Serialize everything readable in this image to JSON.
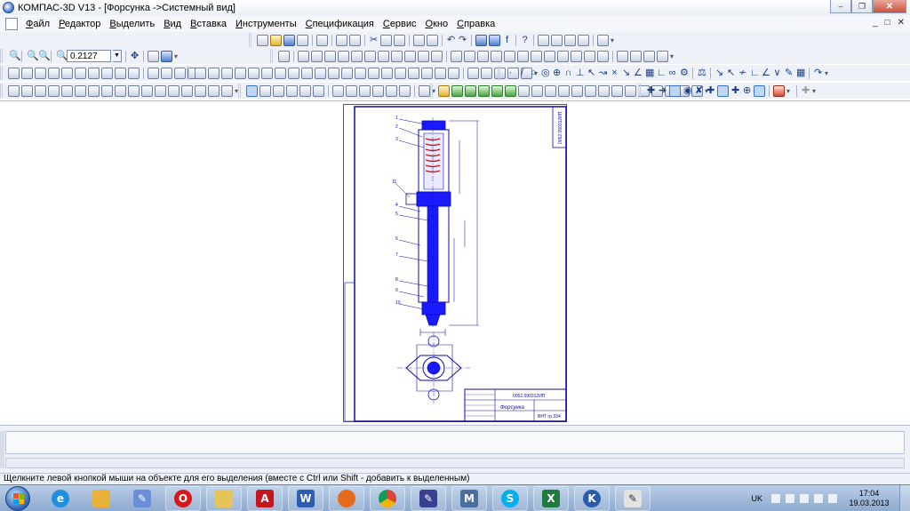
{
  "window": {
    "title": "КОМПАС-3D V13 - [Форсунка ->Системный вид]",
    "controls": [
      "minimize",
      "restore",
      "close"
    ]
  },
  "menu": {
    "items": [
      "Файл",
      "Редактор",
      "Выделить",
      "Вид",
      "Вставка",
      "Инструменты",
      "Спецификация",
      "Сервис",
      "Окно",
      "Справка"
    ],
    "doc_controls": [
      "minimize",
      "restore",
      "close"
    ]
  },
  "toolbar": {
    "zoom_value": "0.2127"
  },
  "drawing": {
    "title_block": {
      "doc_code": "0052.090312ИП",
      "name": "Форсунка",
      "org": "ВНТ гр 334"
    },
    "stamp_code": "0052.090312ИП",
    "leader_numbers": [
      "1",
      "2",
      "3",
      "11",
      "4",
      "5",
      "6",
      "7",
      "8",
      "9",
      "10"
    ]
  },
  "status": {
    "hint": "Щелкните левой кнопкой мыши на объекте для его выделения (вместе с Ctrl или Shift - добавить к выделенным)"
  },
  "taskbar": {
    "apps": [
      {
        "name": "explorer",
        "icon": "folder-icon"
      },
      {
        "name": "internet-explorer",
        "icon": "ie-icon"
      },
      {
        "name": "paint-tool",
        "icon": "paint-icon"
      },
      {
        "name": "opera",
        "icon": "opera-icon"
      },
      {
        "name": "file-manager",
        "icon": "folder-icon"
      },
      {
        "name": "acrobat",
        "icon": "pdf-icon"
      },
      {
        "name": "word",
        "icon": "word-icon"
      },
      {
        "name": "firefox",
        "icon": "firefox-icon"
      },
      {
        "name": "chrome",
        "icon": "chrome-icon"
      },
      {
        "name": "mathcad",
        "icon": "mathcad-icon"
      },
      {
        "name": "skype",
        "icon": "skype-icon"
      },
      {
        "name": "excel",
        "icon": "excel-icon"
      },
      {
        "name": "kompas",
        "icon": "kompas-icon"
      },
      {
        "name": "paint",
        "icon": "brush-icon"
      }
    ],
    "lang": "UK",
    "time": "17:04",
    "date": "19.03.2013"
  },
  "colors": {
    "drawing_lines": "#0a0ab0",
    "section_fill": "#1a1aff",
    "taskbar": "#9ab4d8"
  }
}
